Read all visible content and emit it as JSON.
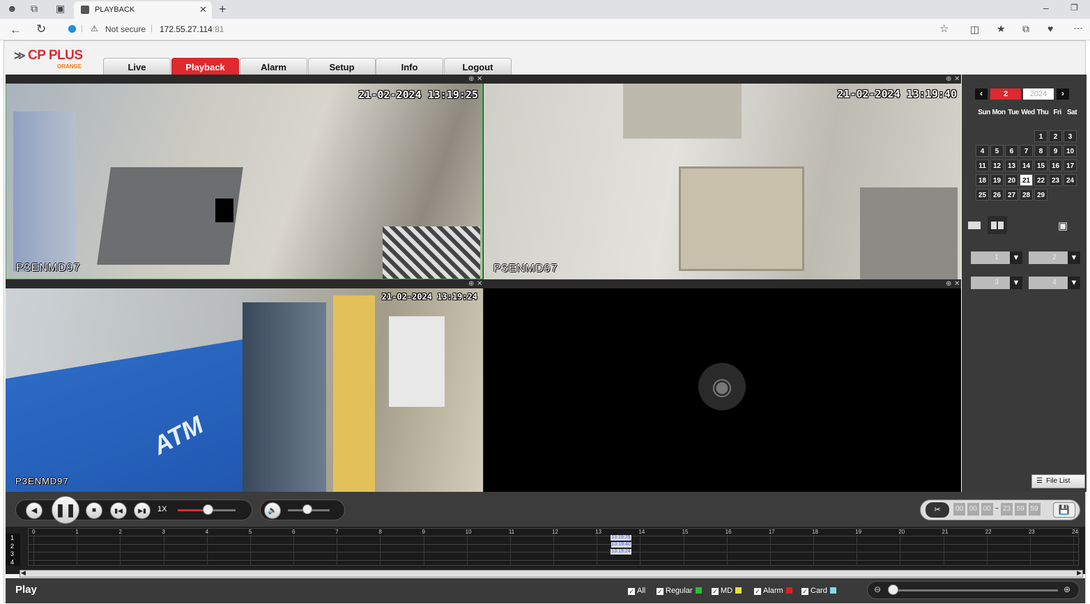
{
  "browser": {
    "tab_title": "PLAYBACK",
    "not_secure": "Not secure",
    "url_host": "172.55.27.114",
    "url_port": ":81"
  },
  "app": {
    "logo_text": "CP PLUS",
    "logo_sub": "ORANGE",
    "nav": [
      "Live",
      "Playback",
      "Alarm",
      "Setup",
      "Info",
      "Logout"
    ],
    "active_nav": "Playback"
  },
  "cameras": [
    {
      "timestamp": "21-02-2024 13:19:25",
      "name": "P3ENMD97"
    },
    {
      "timestamp": "21-02-2024 13:19:40",
      "name": "P3ENMD97"
    },
    {
      "timestamp": "21-02-2024 13:19:24",
      "name": "P3ENMD97"
    }
  ],
  "calendar": {
    "month": "2",
    "year": "2024",
    "weekdays": [
      "Sun",
      "Mon",
      "Tue",
      "Wed",
      "Thu",
      "Fri",
      "Sat"
    ],
    "first_weekday": 4,
    "days_in_month": 29,
    "selected_day": 21
  },
  "channels": [
    "1",
    "2",
    "3",
    "4"
  ],
  "controls": {
    "speed": "1X",
    "time_start": [
      "00",
      "00",
      "00"
    ],
    "time_end": [
      "23",
      "59",
      "59"
    ],
    "file_list": "File List"
  },
  "timeline": {
    "rows": [
      "1",
      "2",
      "3",
      "4"
    ],
    "hours": [
      "0",
      "1",
      "2",
      "3",
      "4",
      "5",
      "6",
      "7",
      "8",
      "9",
      "10",
      "11",
      "12",
      "13",
      "14",
      "15",
      "16",
      "17",
      "18",
      "19",
      "20",
      "21",
      "22",
      "23",
      "24"
    ],
    "markers": [
      "13:19:25",
      "13:19:40",
      "13:19:24"
    ]
  },
  "status": {
    "mode": "Play",
    "legend": [
      {
        "label": "All",
        "color": ""
      },
      {
        "label": "Regular",
        "color": "#22c32e"
      },
      {
        "label": "MD",
        "color": "#e6e23a"
      },
      {
        "label": "Alarm",
        "color": "#e02020"
      },
      {
        "label": "Card",
        "color": "#7fdcef"
      }
    ]
  }
}
